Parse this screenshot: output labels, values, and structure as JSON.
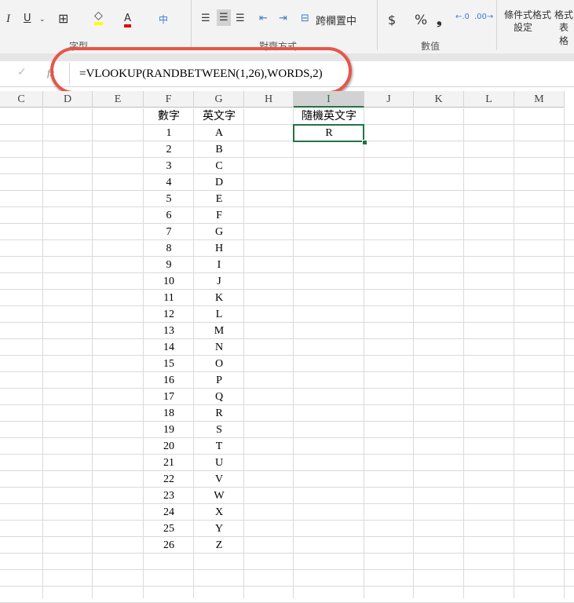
{
  "ribbon": {
    "font_group": "字型",
    "align_group": "對齊方式",
    "number_group": "數值",
    "merge_center": "跨欄置中",
    "conditional_format": "條件式格式",
    "conditional_format2": "設定",
    "format_table": "格式",
    "format_table2": "表格",
    "italic": "I",
    "underline": "U",
    "font_color": "A",
    "currency": "$",
    "percent": "%",
    "comma": "❟",
    "fill_color": "#ffff00",
    "font_color_hex": "#e00000"
  },
  "formula_bar": {
    "formula": "=VLOOKUP(RANDBETWEEN(1,26),WORDS,2)",
    "fx": "fx",
    "confirm": "✓"
  },
  "columns": [
    "C",
    "D",
    "E",
    "F",
    "G",
    "H",
    "I",
    "J",
    "K",
    "L",
    "M"
  ],
  "selected_column": "I",
  "header_f": "數字",
  "header_g": "英文字",
  "header_i": "隨機英文字",
  "result_i": "R",
  "rows": [
    [
      "1",
      "A"
    ],
    [
      "2",
      "B"
    ],
    [
      "3",
      "C"
    ],
    [
      "4",
      "D"
    ],
    [
      "5",
      "E"
    ],
    [
      "6",
      "F"
    ],
    [
      "7",
      "G"
    ],
    [
      "8",
      "H"
    ],
    [
      "9",
      "I"
    ],
    [
      "10",
      "J"
    ],
    [
      "11",
      "K"
    ],
    [
      "12",
      "L"
    ],
    [
      "13",
      "M"
    ],
    [
      "14",
      "N"
    ],
    [
      "15",
      "O"
    ],
    [
      "16",
      "P"
    ],
    [
      "17",
      "Q"
    ],
    [
      "18",
      "R"
    ],
    [
      "19",
      "S"
    ],
    [
      "20",
      "T"
    ],
    [
      "21",
      "U"
    ],
    [
      "22",
      "V"
    ],
    [
      "23",
      "W"
    ],
    [
      "24",
      "X"
    ],
    [
      "25",
      "Y"
    ],
    [
      "26",
      "Z"
    ]
  ]
}
